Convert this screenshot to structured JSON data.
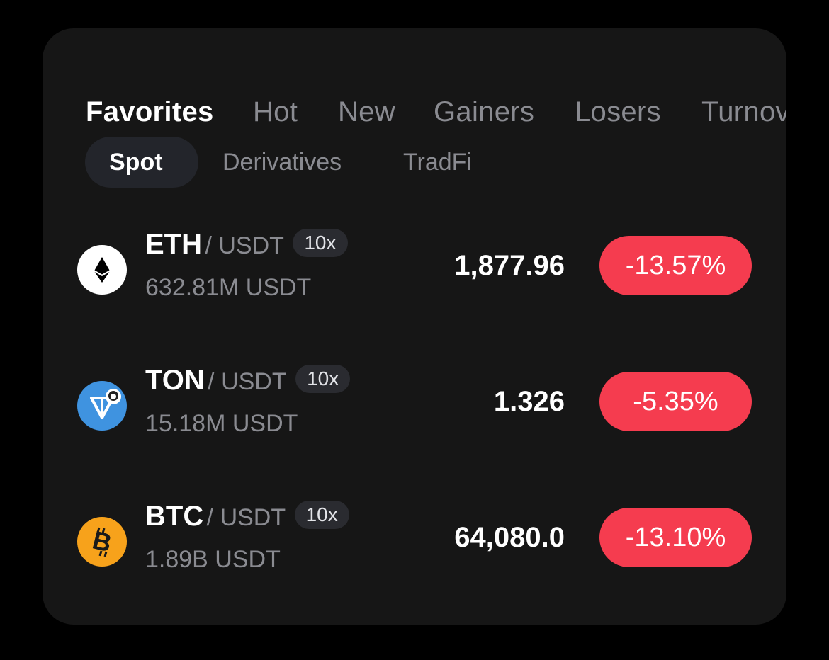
{
  "tabs": [
    {
      "label": "Favorites",
      "active": true
    },
    {
      "label": "Hot"
    },
    {
      "label": "New"
    },
    {
      "label": "Gainers"
    },
    {
      "label": "Losers"
    },
    {
      "label": "Turnover"
    }
  ],
  "subtabs": [
    {
      "label": "Spot",
      "active": true
    },
    {
      "label": "Derivatives"
    },
    {
      "label": "TradFi"
    }
  ],
  "rows": [
    {
      "base": "ETH",
      "quote": "/ USDT",
      "leverage": "10x",
      "volume": "632.81M USDT",
      "price": "1,877.96",
      "change": "-13.57%",
      "icon": "ethereum-icon",
      "icon_color": "#ffffff"
    },
    {
      "base": "TON",
      "quote": "/ USDT",
      "leverage": "10x",
      "volume": "15.18M USDT",
      "price": "1.326",
      "change": "-5.35%",
      "icon": "toncoin-icon",
      "icon_color": "#3f93e0"
    },
    {
      "base": "BTC",
      "quote": "/ USDT",
      "leverage": "10x",
      "volume": "1.89B USDT",
      "price": "64,080.0",
      "change": "-13.10%",
      "icon": "bitcoin-icon",
      "icon_color": "#f7a21b"
    }
  ],
  "colors": {
    "background": "#000000",
    "card": "#161616",
    "negative": "#f53c4f",
    "muted_text": "#8a8b91"
  }
}
